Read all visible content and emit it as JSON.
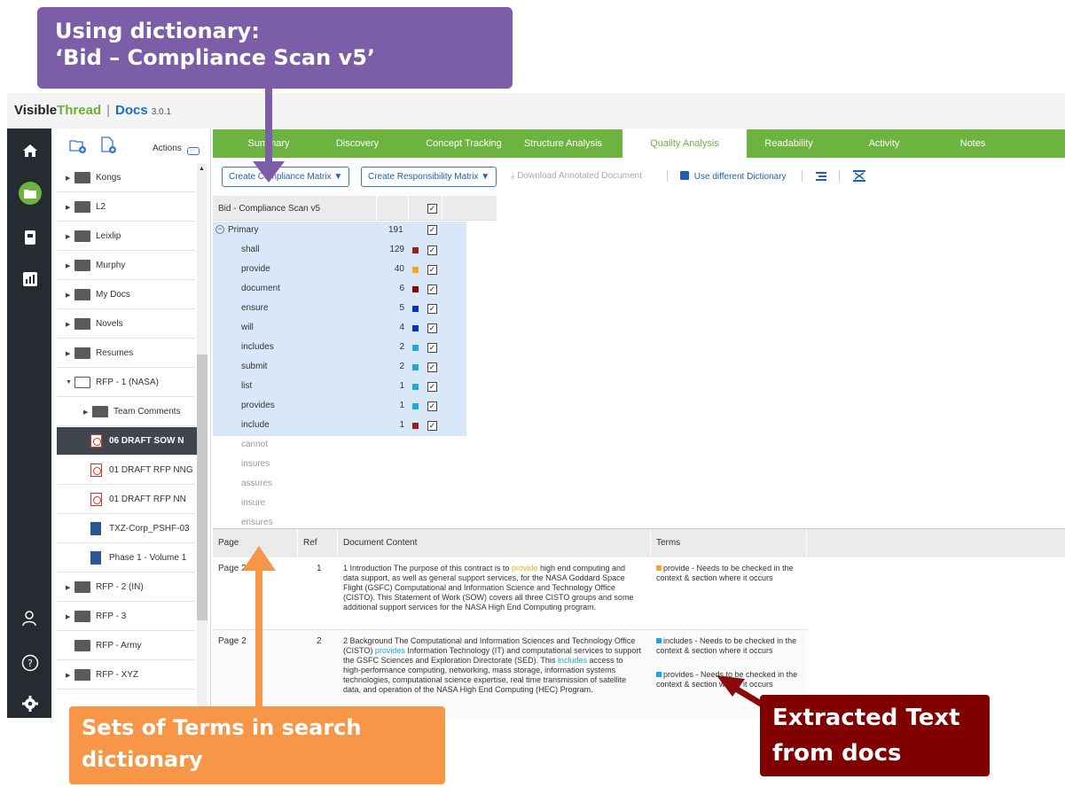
{
  "app": {
    "brand_visible": "Visible",
    "brand_thread": "Thread",
    "separator": "|",
    "product": "Docs",
    "version": "3.0.1"
  },
  "tree": {
    "actions_label": "Actions",
    "items": [
      {
        "label": "Kongs",
        "type": "folder"
      },
      {
        "label": "L2",
        "type": "folder"
      },
      {
        "label": "Leixlip",
        "type": "folder"
      },
      {
        "label": "Murphy",
        "type": "folder"
      },
      {
        "label": "My Docs",
        "type": "folder"
      },
      {
        "label": "Novels",
        "type": "folder"
      },
      {
        "label": "Resumes",
        "type": "folder"
      },
      {
        "label": "RFP - 1 (NASA)",
        "type": "folder-open"
      },
      {
        "label": "Team Comments",
        "type": "folder"
      },
      {
        "label": "06 DRAFT SOW N",
        "type": "pdf"
      },
      {
        "label": "01 DRAFT RFP NNG",
        "type": "pdf"
      },
      {
        "label": "01 DRAFT RFP NN",
        "type": "pdf"
      },
      {
        "label": "TXZ-Corp_PSHF-03",
        "type": "docx"
      },
      {
        "label": "Phase 1 - Volume 1",
        "type": "docx"
      },
      {
        "label": "RFP - 2 (IN)",
        "type": "folder"
      },
      {
        "label": "RFP - 3",
        "type": "folder"
      },
      {
        "label": "RFP - Army",
        "type": "folder"
      },
      {
        "label": "RFP - XYZ",
        "type": "folder"
      }
    ]
  },
  "tabs": [
    "Summary",
    "Discovery",
    "Concept Tracking",
    "Structure Analysis",
    "Quality Analysis",
    "Readability",
    "Activity",
    "Notes"
  ],
  "active_tab": "Quality Analysis",
  "toolbar": {
    "compliance_matrix": "Create Compliance Matrix ▼",
    "responsibility_matrix": "Create Responsibility Matrix ▼",
    "download": "Download Annotated Document",
    "dictionary": "Use different Dictionary"
  },
  "dictionary": {
    "name": "Bid - Compliance Scan v5",
    "group": "Primary",
    "group_count": "191"
  },
  "terms": [
    {
      "term": "shall",
      "count": "129",
      "color": "#9b1c1c",
      "active": true
    },
    {
      "term": "provide",
      "count": "40",
      "color": "#f5a623",
      "active": true
    },
    {
      "term": "document",
      "count": "6",
      "color": "#8b0000",
      "active": true
    },
    {
      "term": "ensure",
      "count": "5",
      "color": "#0033cc",
      "active": true
    },
    {
      "term": "will",
      "count": "4",
      "color": "#0033cc",
      "active": true
    },
    {
      "term": "includes",
      "count": "2",
      "color": "#1fa7e0",
      "active": true
    },
    {
      "term": "submit",
      "count": "2",
      "color": "#1fa7e0",
      "active": true
    },
    {
      "term": "list",
      "count": "1",
      "color": "#1fa7e0",
      "active": true
    },
    {
      "term": "provides",
      "count": "1",
      "color": "#1fa7e0",
      "active": true
    },
    {
      "term": "include",
      "count": "1",
      "color": "#9b1c1c",
      "active": true
    },
    {
      "term": "cannot",
      "active": false
    },
    {
      "term": "insures",
      "active": false
    },
    {
      "term": "assures",
      "active": false
    },
    {
      "term": "insure",
      "active": false
    },
    {
      "term": "ensures",
      "active": false
    }
  ],
  "results": {
    "headers": {
      "page": "Page",
      "ref": "Ref",
      "content": "Document Content",
      "terms": "Terms"
    },
    "rows": [
      {
        "page": "Page 2",
        "ref": "1",
        "content_before": "1 Introduction The purpose of this contract is to ",
        "content_hl": "provide",
        "content_after": " high end computing and data support, as well as general support services, for the NASA Goddard Space Flight (GSFC) Computational and Information Science and Technology Office (CISTO). This Statement of Work (SOW) covers all three CISTO groups and some additional support services for the NASA High End Computing program.",
        "terms": [
          {
            "text": "provide - Needs to be checked in the context & section where it occurs",
            "color": "#f5a623"
          }
        ]
      },
      {
        "page": "Page 2",
        "ref": "2",
        "content_a": "2 Background The Computational and Information Sciences and Technology Office (CISTO) ",
        "content_hl1": "provides",
        "content_b": " Information Technology (IT) and computational services to support the GSFC Sciences and Exploration Directorate (SED). This ",
        "content_hl2": "includes",
        "content_c": " access to high-performance computing, networking, mass storage, information systems technologies, computational science expertise, real time transmission of satellite data, and operation of the NASA High End Computing (HEC) Program.",
        "terms": [
          {
            "text": "includes - Needs to be checked in the context & section where it occurs",
            "color": "#1fa7e0"
          },
          {
            "text": "provides - Needs to be checked in the context & section where it occurs",
            "color": "#1fa7e0"
          }
        ]
      }
    ]
  },
  "callouts": {
    "top_line1": "Using dictionary:",
    "top_line2": "‘Bid – Compliance Scan v5’",
    "bottom_left_line1": "Sets of Terms in search",
    "bottom_left_line2": "dictionary",
    "bottom_right_line1": "Extracted Text",
    "bottom_right_line2": "from docs"
  }
}
